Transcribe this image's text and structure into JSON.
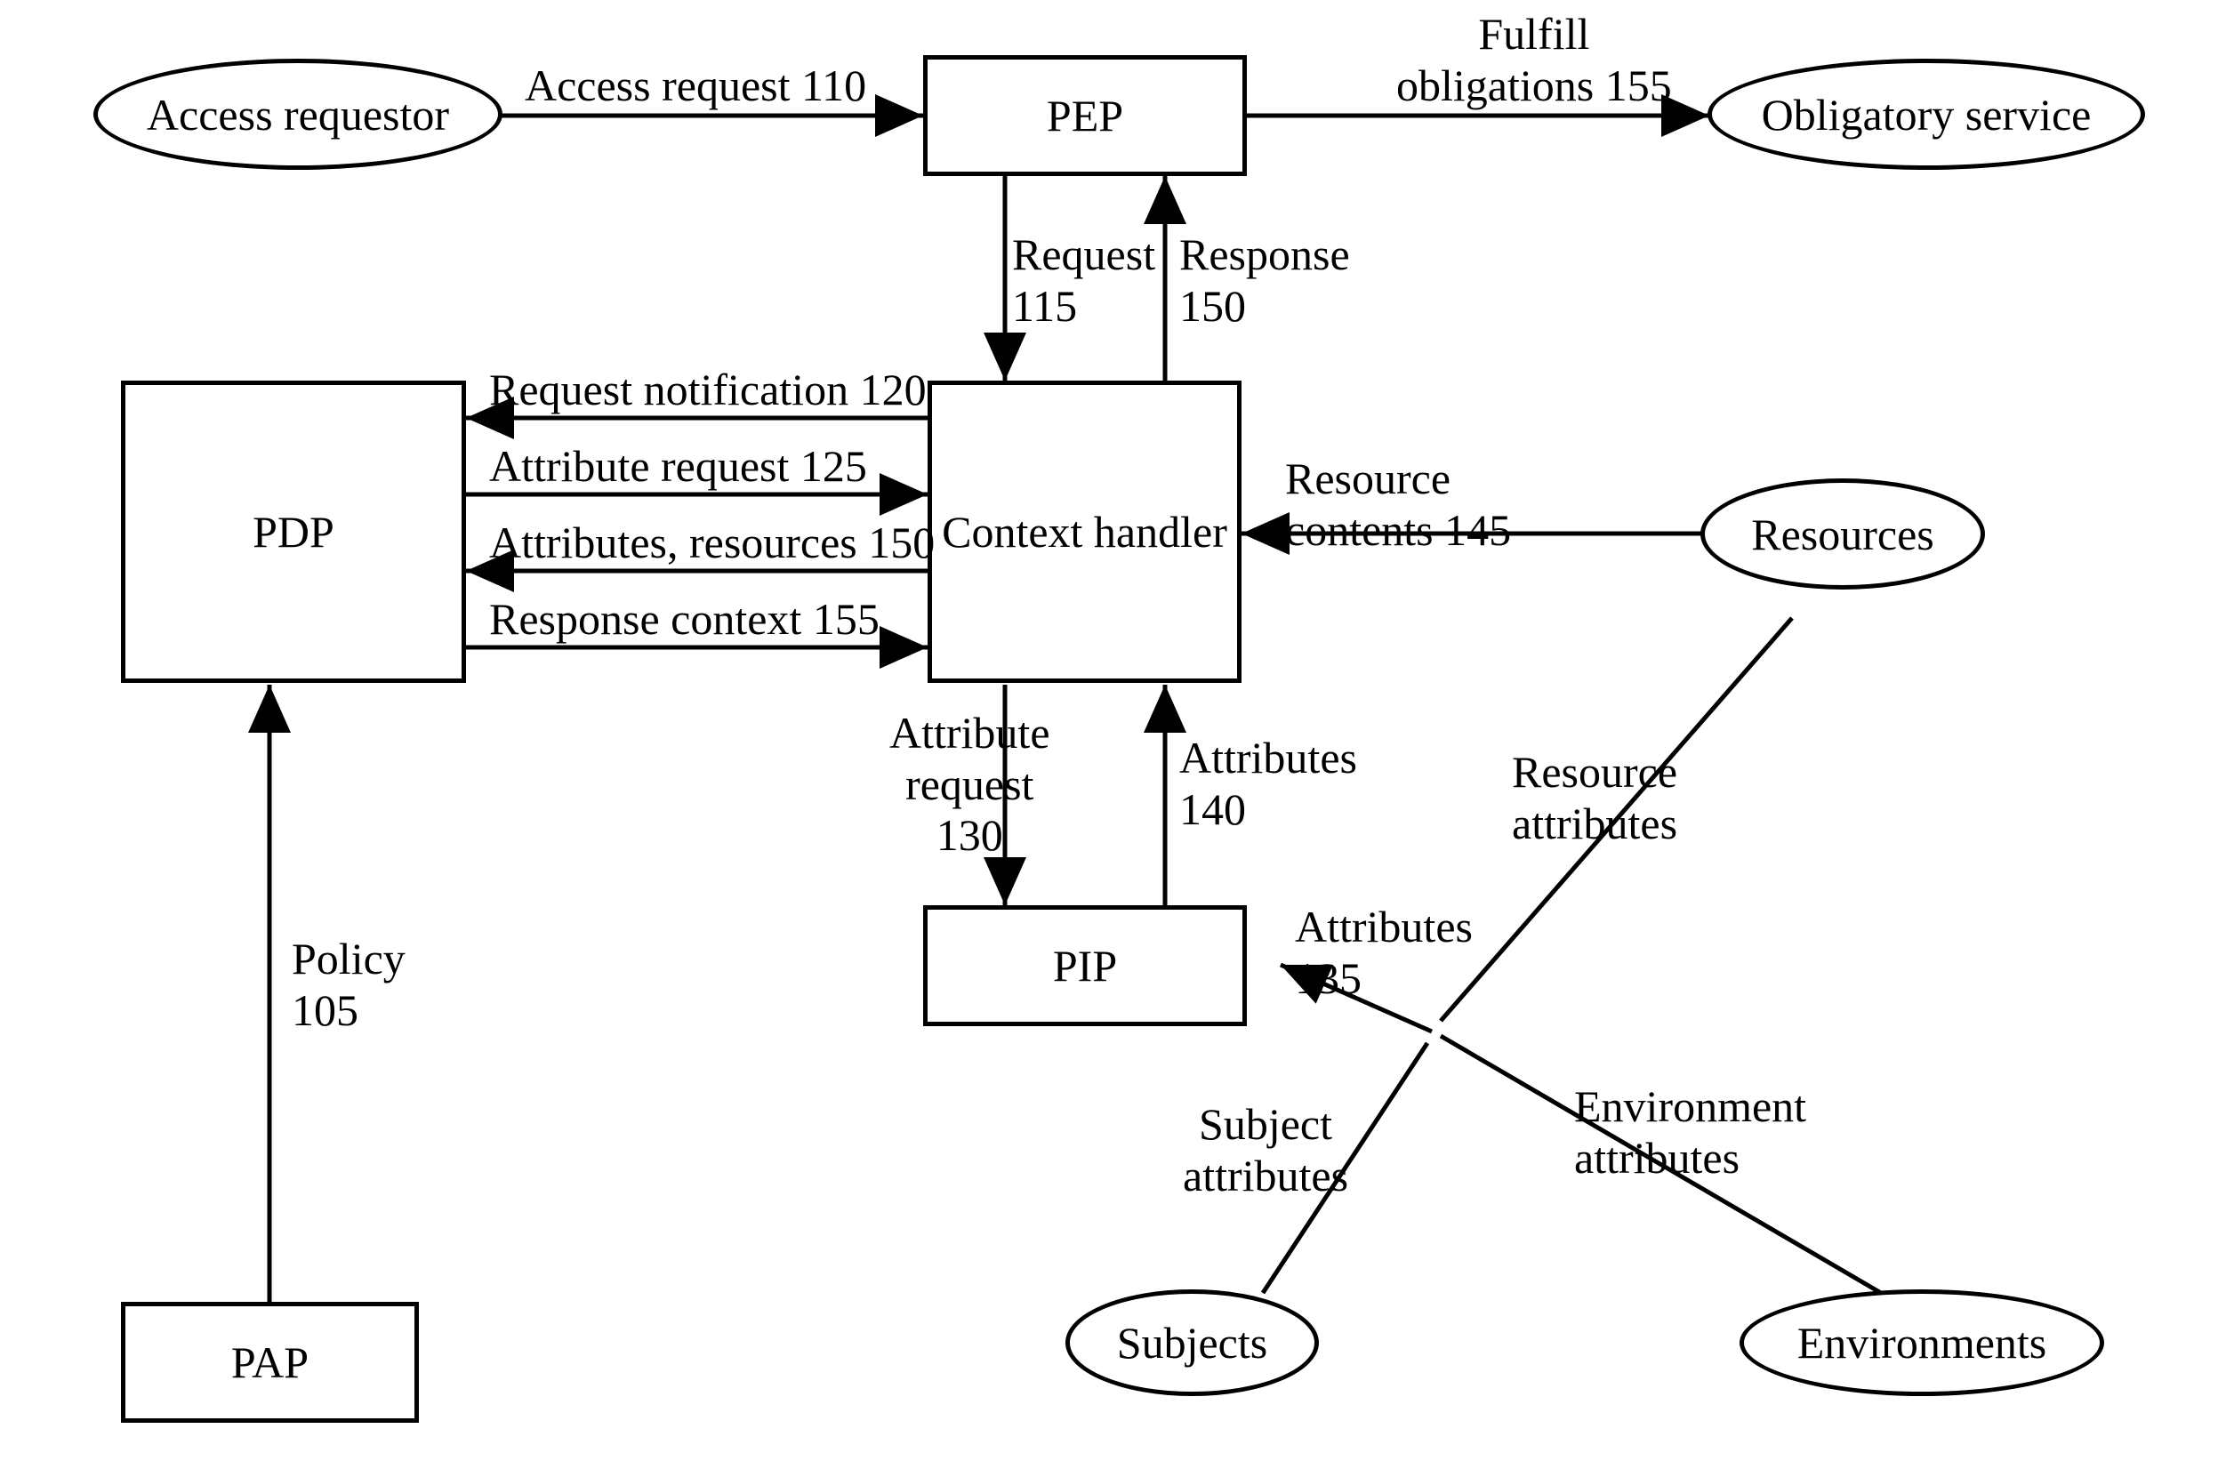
{
  "nodes": {
    "access_requestor": "Access requestor",
    "pep": "PEP",
    "obligatory_service": "Obligatory service",
    "pdp": "PDP",
    "context_handler": "Context handler",
    "resources": "Resources",
    "pap": "PAP",
    "pip": "PIP",
    "subjects": "Subjects",
    "environments": "Environments"
  },
  "edges": {
    "access_request": "Access request 110",
    "fulfill_obligations": "Fulfill\nobligations 155",
    "request_115": "Request\n115",
    "response_150": "Response\n150",
    "request_notification_120": "Request notification 120",
    "attribute_request_125": "Attribute request 125",
    "attributes_resources_150": "Attributes, resources 150",
    "response_context_155": "Response context 155",
    "resource_contents_145": "Resource\ncontents 145",
    "attribute_request_130": "Attribute\nrequest\n130",
    "attributes_140": "Attributes\n140",
    "policy_105": "Policy\n105",
    "attributes_135": "Attributes\n135",
    "resource_attributes": "Resource\nattributes",
    "subject_attributes": "Subject\nattributes",
    "environment_attributes": "Environment\nattributes"
  }
}
